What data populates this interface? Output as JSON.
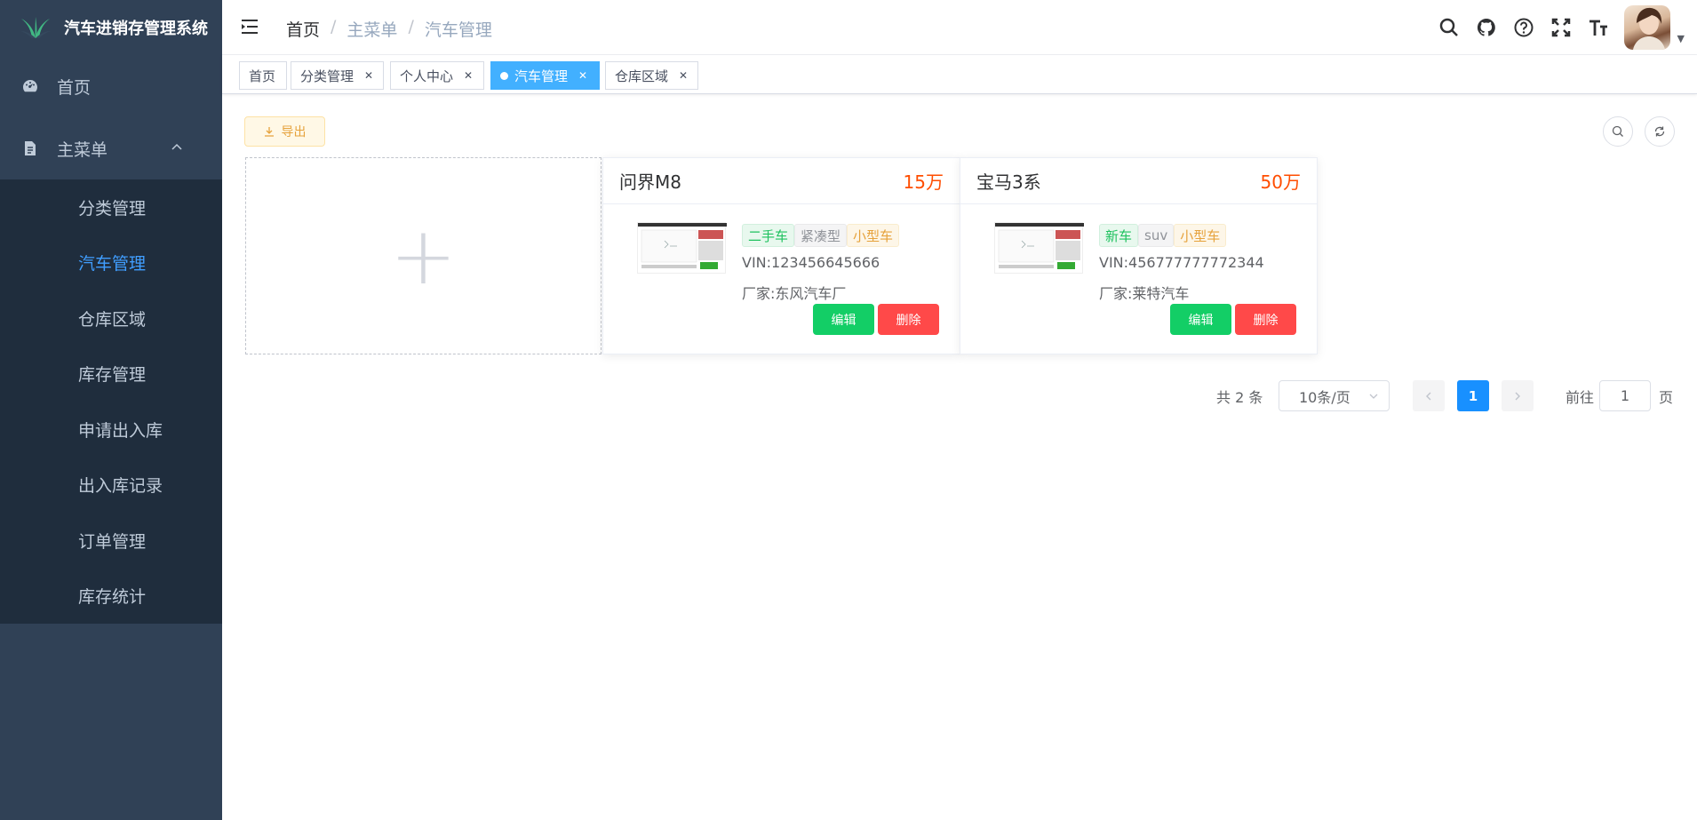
{
  "app": {
    "title": "汽车进销存管理系统"
  },
  "sidebar": {
    "home": "首页",
    "main_menu": "主菜单",
    "sub_items": [
      "分类管理",
      "汽车管理",
      "仓库区域",
      "库存管理",
      "申请出入库",
      "出入库记录",
      "订单管理",
      "库存统计"
    ],
    "active_index": 1
  },
  "breadcrumb": {
    "home": "首页",
    "menu": "主菜单",
    "current": "汽车管理",
    "sep": "/"
  },
  "tags": [
    {
      "label": "首页",
      "closable": false
    },
    {
      "label": "分类管理",
      "closable": true
    },
    {
      "label": "个人中心",
      "closable": true
    },
    {
      "label": "汽车管理",
      "closable": true,
      "active": true
    },
    {
      "label": "仓库区域",
      "closable": true
    }
  ],
  "toolbar": {
    "export_label": "导出"
  },
  "cars": [
    {
      "name": "问界M8",
      "price": "15万",
      "tags": [
        "二手车",
        "紧凑型",
        "小型车"
      ],
      "vin": "VIN:123456645666",
      "maker": "厂家:东风汽车厂",
      "edit": "编辑",
      "delete": "删除"
    },
    {
      "name": "宝马3系",
      "price": "50万",
      "tags": [
        "新车",
        "suv",
        "小型车"
      ],
      "vin": "VIN:456777777772344",
      "maker": "厂家:莱特汽车",
      "edit": "编辑",
      "delete": "删除"
    }
  ],
  "add_card": {
    "symbol": "+"
  },
  "pagination": {
    "total": "共 2 条",
    "page_size": "10条/页",
    "current_page": "1",
    "goto_label": "前往",
    "goto_value": "1",
    "page_suffix": "页"
  },
  "colors": {
    "sidebar": "#304156",
    "submenu": "#1f2d3d",
    "active": "#409eff",
    "success": "#13ce66",
    "danger": "#ff4949",
    "price": "#ff4d00"
  }
}
